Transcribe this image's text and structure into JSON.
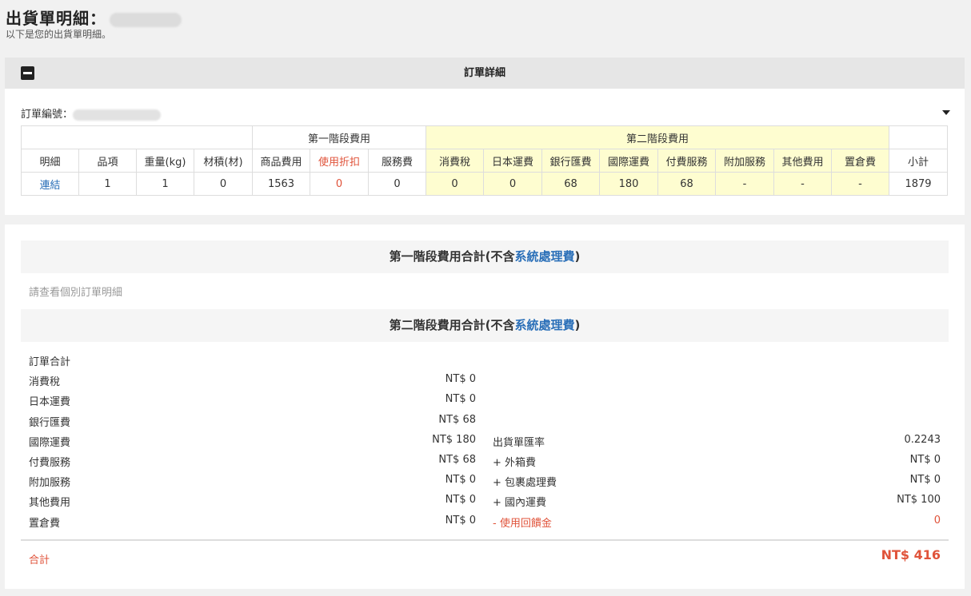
{
  "header": {
    "title": "出貨單明細：",
    "subtitle": "以下是您的出貨單明細。"
  },
  "panel": {
    "title": "訂單詳細",
    "order_no_label": "訂單編號："
  },
  "table": {
    "group_stage1": "第一階段費用",
    "group_stage2": "第二階段費用",
    "columns": [
      "明細",
      "品項",
      "重量(kg)",
      "材積(材)",
      "商品費用",
      "使用折扣",
      "服務費",
      "消費稅",
      "日本運費",
      "銀行匯費",
      "國際運費",
      "付費服務",
      "附加服務",
      "其他費用",
      "置倉費",
      "小計"
    ],
    "row": [
      "連結",
      "1",
      "1",
      "0",
      "1563",
      "0",
      "0",
      "0",
      "0",
      "68",
      "180",
      "68",
      "-",
      "-",
      "-",
      "1879"
    ]
  },
  "summary": {
    "stage1_title_prefix": "第一階段費用合計(不含",
    "stage1_title_link": "系統處理費",
    "stage1_title_suffix": ")",
    "stage1_note": "請查看個別訂單明細",
    "stage2_title_prefix": "第二階段費用合計(不含",
    "stage2_title_link": "系統處理費",
    "stage2_title_suffix": ")",
    "order_total_label": "訂單合計",
    "left_items": [
      {
        "label": "消費稅",
        "value": "NT$ 0"
      },
      {
        "label": "日本運費",
        "value": "NT$ 0"
      },
      {
        "label": "銀行匯費",
        "value": "NT$ 68"
      },
      {
        "label": "國際運費",
        "value": "NT$ 180"
      },
      {
        "label": "付費服務",
        "value": "NT$ 68"
      },
      {
        "label": "附加服務",
        "value": "NT$ 0"
      },
      {
        "label": "其他費用",
        "value": "NT$ 0"
      },
      {
        "label": "置倉費",
        "value": "NT$ 0"
      }
    ],
    "right_items": [
      {
        "label": "出貨單匯率",
        "value": "0.2243"
      },
      {
        "label": "+ 外箱費",
        "value": "NT$ 0"
      },
      {
        "label": "+ 包裹處理費",
        "value": "NT$ 0"
      },
      {
        "label": "+ 國內運費",
        "value": "NT$ 100"
      },
      {
        "label": "- 使用回饋金",
        "value": "0"
      }
    ],
    "total_label": "合計",
    "total_value": "NT$ 416"
  },
  "colors": {
    "accent_red": "#e0533a",
    "link_blue": "#2a6fb8",
    "stage2_bg": "#fefdd0"
  }
}
